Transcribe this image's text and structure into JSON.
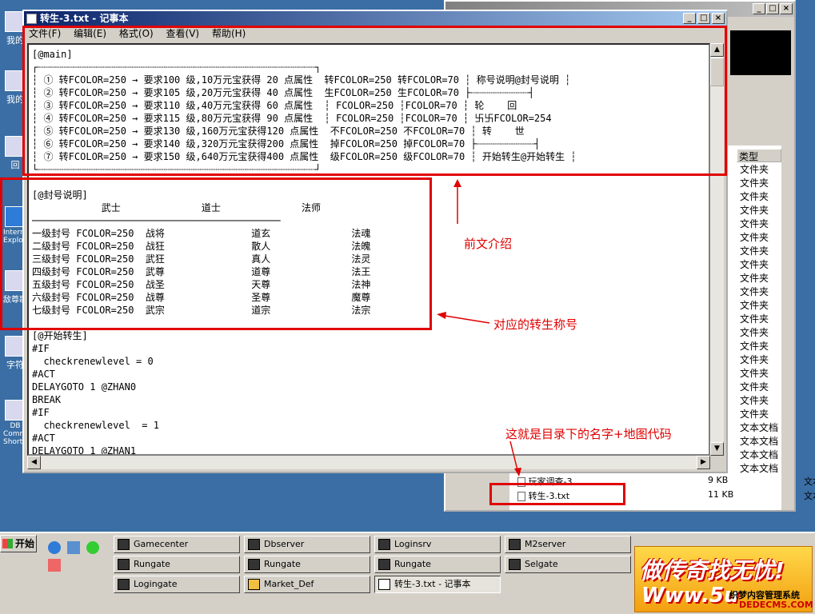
{
  "notepad": {
    "title": "转生-3.txt - 记事本",
    "menu": [
      "文件(F)",
      "编辑(E)",
      "格式(O)",
      "查看(V)",
      "帮助(H)"
    ],
    "lines": [
      "[@main]",
      "┌┈┈┈┈┈┈┈┈┈┈┈┈┈┈┈┈┈┈┈┈┈┈┈┈┈┈┈┈┈┈┈┈┈┈┈┈┈┈┈┈┈┈┈┈┈┈┈┈┐",
      "┆ ① 转FCOLOR=250 → 要求100 级,10万元宝获得 20 点属性  转FCOLOR=250 转FCOLOR=70 ┆ 称号说明@封号说明 ┆",
      "┆ ② 转FCOLOR=250 → 要求105 级,20万元宝获得 40 点属性  生FCOLOR=250 生FCOLOR=70 ├┈┈┈┈┈┈┈┈┈┈┤",
      "┆ ③ 转FCOLOR=250 → 要求110 级,40万元宝获得 60 点属性  ┆ FCOLOR=250 ┆FCOLOR=70 ┆ 轮    回",
      "┆ ④ 转FCOLOR=250 → 要求115 级,80万元宝获得 90 点属性  ┆ FCOLOR=250 ┆FCOLOR=70 ┆ 卐卐FCOLOR=254",
      "┆ ⑤ 转FCOLOR=250 → 要求130 级,160万元宝获得120 点属性  不FCOLOR=250 不FCOLOR=70 ┆ 转    世",
      "┆ ⑥ 转FCOLOR=250 → 要求140 级,320万元宝获得200 点属性  掉FCOLOR=250 掉FCOLOR=70 ├┈┈┈┈┈┈┈┈┈┈┤",
      "┆ ⑦ 转FCOLOR=250 → 要求150 级,640万元宝获得400 点属性  级FCOLOR=250 级FCOLOR=70 ┆ 开始转生@开始转生 ┆",
      "└┈┈┈┈┈┈┈┈┈┈┈┈┈┈┈┈┈┈┈┈┈┈┈┈┈┈┈┈┈┈┈┈┈┈┈┈┈┈┈┈┈┈┈┈┈┈┈┈┘",
      "",
      "[@封号说明]",
      "            武士              道士              法师",
      "───────────────────────────────────────────",
      "一级封号 FCOLOR=250  战将               道玄              法魂",
      "二级封号 FCOLOR=250  战狂               散人              法魄",
      "三级封号 FCOLOR=250  武狂               真人              法灵",
      "四级封号 FCOLOR=250  武尊               道尊              法王",
      "五级封号 FCOLOR=250  战圣               天尊              法神",
      "六级封号 FCOLOR=250  战尊               圣尊              魔尊",
      "七级封号 FCOLOR=250  武宗               道宗              法宗",
      "",
      "[@开始转生]",
      "#IF",
      "  checkrenewlevel = 0",
      "#ACT",
      "DELAYGOTO 1 @ZHAN0",
      "BREAK",
      "#IF",
      "  checkrenewlevel  = 1",
      "#ACT",
      "DELAYGOTO 1 @ZHAN1"
    ]
  },
  "background_window": {
    "title": "",
    "column_header": "类型",
    "types": [
      "文件夹",
      "文件夹",
      "文件夹",
      "文件夹",
      "文件夹",
      "文件夹",
      "文件夹",
      "文件夹",
      "文件夹",
      "文件夹",
      "文件夹",
      "文件夹",
      "文件夹",
      "文件夹",
      "文件夹",
      "文件夹",
      "文件夹",
      "文件夹",
      "文件夹",
      "文本文档",
      "文本文档",
      "文本文档",
      "文本文档",
      "文本文档",
      "文本文档",
      "文本文档"
    ],
    "file1": {
      "name": "玩家调查-3",
      "size": "9 KB",
      "type": "文本文档"
    },
    "file2": {
      "name": "转生-3.txt",
      "size": "11 KB",
      "type": "文本文档"
    }
  },
  "desktop_icons": [
    "我的",
    "我的",
    "回",
    "Internet Explorer",
    "敌尊歌",
    "字符",
    "DB Commander Shortcut"
  ],
  "annotations": {
    "intro": "前文介绍",
    "titles": "对应的转生称号",
    "filename": "这就是目录下的名字+地图代码"
  },
  "taskbar": {
    "start": "开始",
    "buttons": [
      "Gamecenter",
      "Dbserver",
      "Loginsrv",
      "M2server",
      "Rungate",
      "Rungate",
      "Rungate",
      "Selgate",
      "Logingate",
      "Market_Def",
      "转生-3.txt - 记事本"
    ]
  },
  "watermark": {
    "line1": "做传奇找无忧!",
    "line2": "Www.5u",
    "line3": "织梦内容管理系统",
    "line4": "DEDECMS.COM"
  },
  "colors": {
    "annotation": "#e00000",
    "title_active": "#0a246a",
    "desktop": "#3a6ea5"
  }
}
